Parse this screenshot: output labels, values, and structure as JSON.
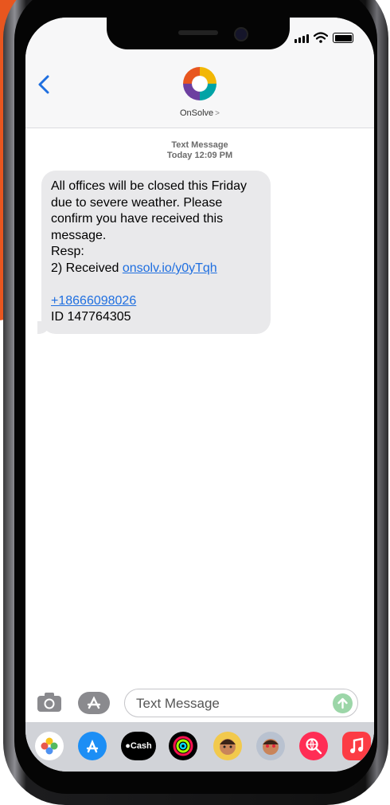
{
  "header": {
    "contact_name": "OnSolve",
    "contact_chevron": ">"
  },
  "thread": {
    "meta_label": "Text Message",
    "meta_time": "Today 12:09 PM",
    "message": {
      "lines": [
        "All offices will be closed this Friday",
        "due to severe weather. Please",
        "confirm you have received this",
        "message.",
        "Resp:"
      ],
      "resp_prefix": "2) Received ",
      "link": "onsolv.io/y0yTqh",
      "phone": "+18666098026",
      "id_line": "ID 147764305"
    }
  },
  "compose": {
    "placeholder": "Text Message"
  },
  "tray": {
    "cash_label": "Cash"
  },
  "colors": {
    "accent": "#1f6fe0",
    "brand_orange": "#e8561f",
    "bubble": "#e9e9eb"
  }
}
